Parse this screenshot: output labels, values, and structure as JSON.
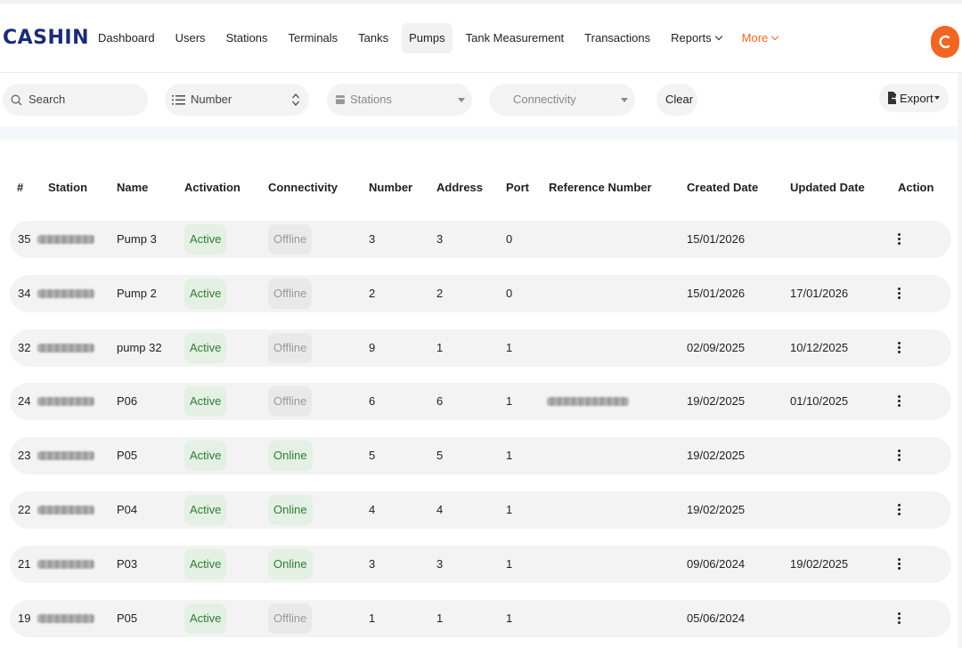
{
  "app": {
    "logo": "CASHIN",
    "accent": "#f26522",
    "brand": "#1d2a78"
  },
  "nav": {
    "items": [
      {
        "label": "Dashboard"
      },
      {
        "label": "Users"
      },
      {
        "label": "Stations"
      },
      {
        "label": "Terminals"
      },
      {
        "label": "Tanks"
      },
      {
        "label": "Pumps",
        "active": true
      },
      {
        "label": "Tank Measurement"
      },
      {
        "label": "Transactions"
      },
      {
        "label": "Reports",
        "dropdown": true
      },
      {
        "label": "More",
        "dropdown": true
      }
    ]
  },
  "filters": {
    "search_placeholder": "Search",
    "number_label": "Number",
    "stations_placeholder": "Stations",
    "connectivity_placeholder": "Connectivity",
    "clear_label": "Clear",
    "export_label": "Export"
  },
  "table": {
    "headers": [
      "#",
      "Station",
      "Name",
      "Activation",
      "Connectivity",
      "Number",
      "Address",
      "Port",
      "Reference Number",
      "Created Date",
      "Updated Date",
      "Action"
    ],
    "rows": [
      {
        "id": "35",
        "name": "Pump 3",
        "activation": "Active",
        "connectivity": "Offline",
        "number": "3",
        "address": "3",
        "port": "0",
        "reference_redacted": false,
        "created": "15/01/2026",
        "updated": ""
      },
      {
        "id": "34",
        "name": "Pump 2",
        "activation": "Active",
        "connectivity": "Offline",
        "number": "2",
        "address": "2",
        "port": "0",
        "reference_redacted": false,
        "created": "15/01/2026",
        "updated": "17/01/2026"
      },
      {
        "id": "32",
        "name": "pump 32",
        "activation": "Active",
        "connectivity": "Offline",
        "number": "9",
        "address": "1",
        "port": "1",
        "reference_redacted": false,
        "created": "02/09/2025",
        "updated": "10/12/2025"
      },
      {
        "id": "24",
        "name": "P06",
        "activation": "Active",
        "connectivity": "Offline",
        "number": "6",
        "address": "6",
        "port": "1",
        "reference_redacted": true,
        "created": "19/02/2025",
        "updated": "01/10/2025"
      },
      {
        "id": "23",
        "name": "P05",
        "activation": "Active",
        "connectivity": "Online",
        "number": "5",
        "address": "5",
        "port": "1",
        "reference_redacted": false,
        "created": "19/02/2025",
        "updated": ""
      },
      {
        "id": "22",
        "name": "P04",
        "activation": "Active",
        "connectivity": "Online",
        "number": "4",
        "address": "4",
        "port": "1",
        "reference_redacted": false,
        "created": "19/02/2025",
        "updated": ""
      },
      {
        "id": "21",
        "name": "P03",
        "activation": "Active",
        "connectivity": "Online",
        "number": "3",
        "address": "3",
        "port": "1",
        "reference_redacted": false,
        "created": "09/06/2024",
        "updated": "19/02/2025"
      },
      {
        "id": "19",
        "name": "P05",
        "activation": "Active",
        "connectivity": "Offline",
        "number": "1",
        "address": "1",
        "port": "1",
        "reference_redacted": false,
        "created": "05/06/2024",
        "updated": ""
      }
    ]
  },
  "icons": {
    "search": "search-icon",
    "list": "list-icon",
    "sort": "sort-icon",
    "station": "station-icon",
    "export": "export-icon",
    "avatar": "user-avatar",
    "action": "more-vertical-icon"
  }
}
